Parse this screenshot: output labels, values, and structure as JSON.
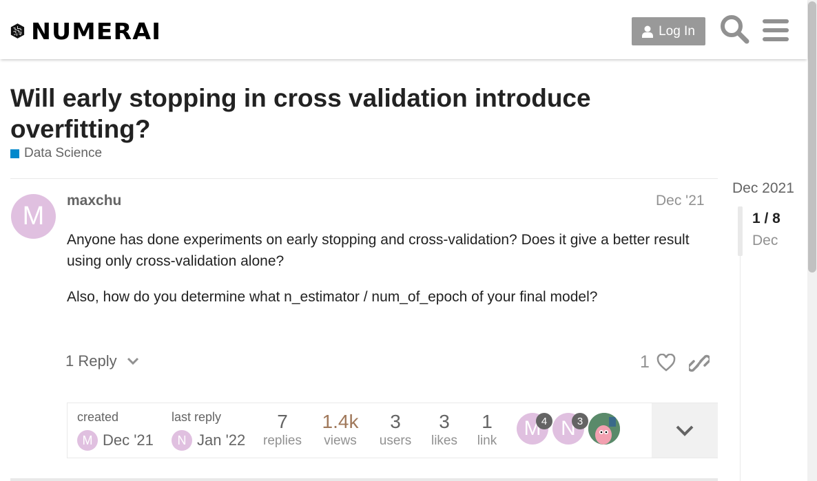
{
  "header": {
    "logo_text": "NUMERAI",
    "login_label": "Log In"
  },
  "topic": {
    "title": "Will early stopping in cross validation introduce overfitting?",
    "category": "Data Science",
    "category_color": "#0088cc"
  },
  "post": {
    "avatar_letter": "M",
    "avatar_color": "#e0c0e0",
    "username": "maxchu",
    "date": "Dec '21",
    "paragraphs": [
      "Anyone has done experiments on early stopping and cross-validation? Does it give a better result using only cross-validation alone?",
      "Also, how do you determine what n_estimator / num_of_epoch of your final model?"
    ],
    "reply_label": "1 Reply",
    "like_count": "1"
  },
  "topic_map": {
    "created_label": "created",
    "created_avatar": "M",
    "created_date": "Dec '21",
    "last_reply_label": "last reply",
    "last_reply_avatar": "N",
    "last_reply_date": "Jan '22",
    "stats": [
      {
        "num": "7",
        "label": "replies"
      },
      {
        "num": "1.4k",
        "label": "views"
      },
      {
        "num": "3",
        "label": "users"
      },
      {
        "num": "3",
        "label": "likes"
      },
      {
        "num": "1",
        "label": "link"
      }
    ],
    "participants": [
      {
        "letter": "M",
        "count": "4",
        "color": "#e0c0e0"
      },
      {
        "letter": "N",
        "count": "3",
        "color": "#e0c0e0"
      },
      {
        "letter": "",
        "count": "",
        "color": "#5a8a6a"
      }
    ]
  },
  "timeline": {
    "top_date": "Dec 2021",
    "position": "1 / 8",
    "month": "Dec"
  }
}
